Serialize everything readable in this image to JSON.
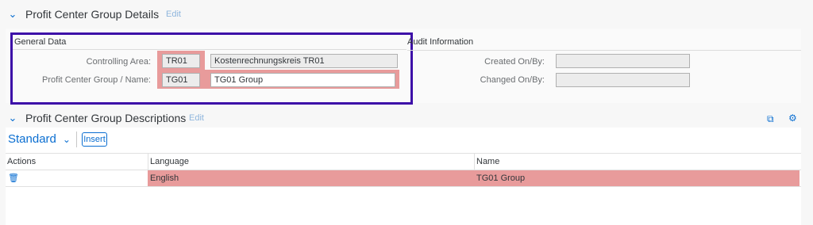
{
  "header": {
    "title": "Profit Center Group Details",
    "edit_label": "Edit"
  },
  "general_data": {
    "title": "General Data",
    "controlling_area_label": "Controlling Area:",
    "controlling_area_code": "TR01",
    "controlling_area_name": "Kostenrechnungskreis TR01",
    "group_name_label": "Profit Center Group / Name:",
    "group_code": "TG01",
    "group_name": "TG01 Group"
  },
  "audit": {
    "title": "Audit Information",
    "created_label": "Created On/By:",
    "created_value": "",
    "changed_label": "Changed On/By:",
    "changed_value": ""
  },
  "descriptions": {
    "title": "Profit Center Group Descriptions",
    "edit_label": "Edit",
    "variant": "Standard",
    "insert_label": "Insert",
    "columns": [
      "Actions",
      "Language",
      "Name"
    ],
    "rows": [
      {
        "language": "English",
        "name": "TG01 Group"
      }
    ]
  },
  "colors": {
    "accent": "#0a6ed1",
    "highlight": "#e89b9b",
    "annotation_border": "#3d0fa8"
  }
}
